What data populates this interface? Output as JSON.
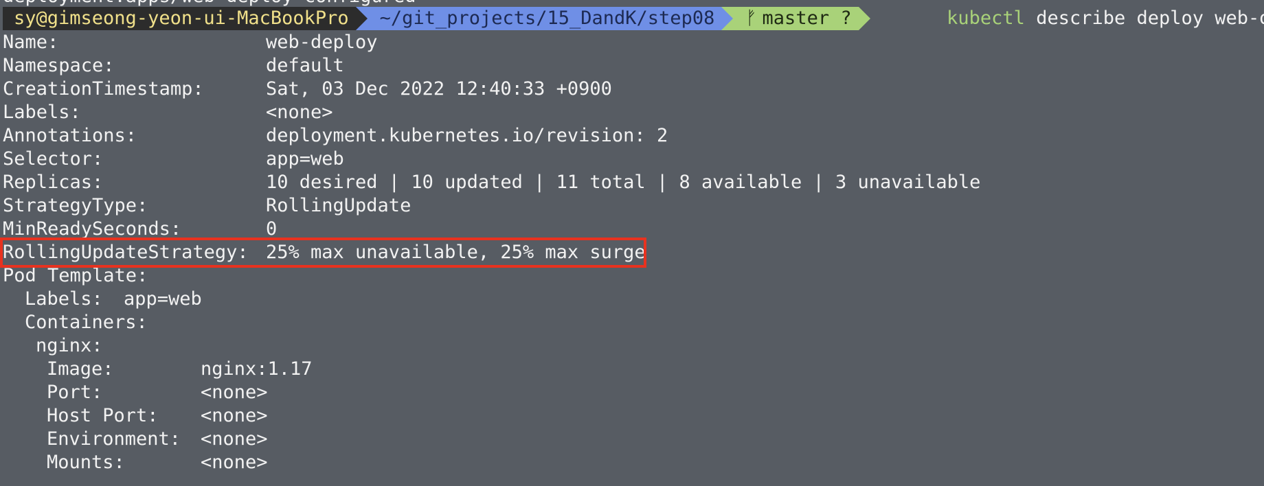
{
  "previous_output": "deployment.apps/web-deploy configured",
  "prompt": {
    "user_host": "sy@gimseong-yeon-ui-MacBookPro",
    "path": "~/git_projects/15_DandK/step08",
    "git_branch_icon": "git-branch-icon",
    "git_branch": "master ?",
    "command_name": "kubectl",
    "command_args": "describe deploy web-deploy"
  },
  "colors": {
    "background": "#575c63",
    "highlight": "#e8321f",
    "user_segment": "#2c2c2c",
    "path_segment": "#6f8fe6",
    "git_segment": "#a9d279"
  },
  "output": {
    "name": {
      "key": "Name:",
      "value": "web-deploy"
    },
    "namespace": {
      "key": "Namespace:",
      "value": "default"
    },
    "creation": {
      "key": "CreationTimestamp:",
      "value": "Sat, 03 Dec 2022 12:40:33 +0900"
    },
    "labels": {
      "key": "Labels:",
      "value": "<none>"
    },
    "annotations": {
      "key": "Annotations:",
      "value": "deployment.kubernetes.io/revision: 2"
    },
    "selector": {
      "key": "Selector:",
      "value": "app=web"
    },
    "replicas": {
      "key": "Replicas:",
      "value": "10 desired | 10 updated | 11 total | 8 available | 3 unavailable"
    },
    "strategy_type": {
      "key": "StrategyType:",
      "value": "RollingUpdate"
    },
    "min_ready": {
      "key": "MinReadySeconds:",
      "value": "0"
    },
    "rolling_update": {
      "key": "RollingUpdateStrategy:",
      "value": "25% max unavailable, 25% max surge"
    },
    "pod_template": {
      "key": "Pod Template:"
    },
    "pod_labels": {
      "key": "Labels:",
      "value": "app=web"
    },
    "containers": {
      "key": "Containers:"
    },
    "container_name": {
      "key": "nginx:"
    },
    "image": {
      "key": "Image:",
      "value": "nginx:1.17"
    },
    "port": {
      "key": "Port:",
      "value": "<none>"
    },
    "host_port": {
      "key": "Host Port:",
      "value": "<none>"
    },
    "environment": {
      "key": "Environment:",
      "value": "<none>"
    },
    "mounts": {
      "key": "Mounts:",
      "value": "<none>"
    }
  }
}
